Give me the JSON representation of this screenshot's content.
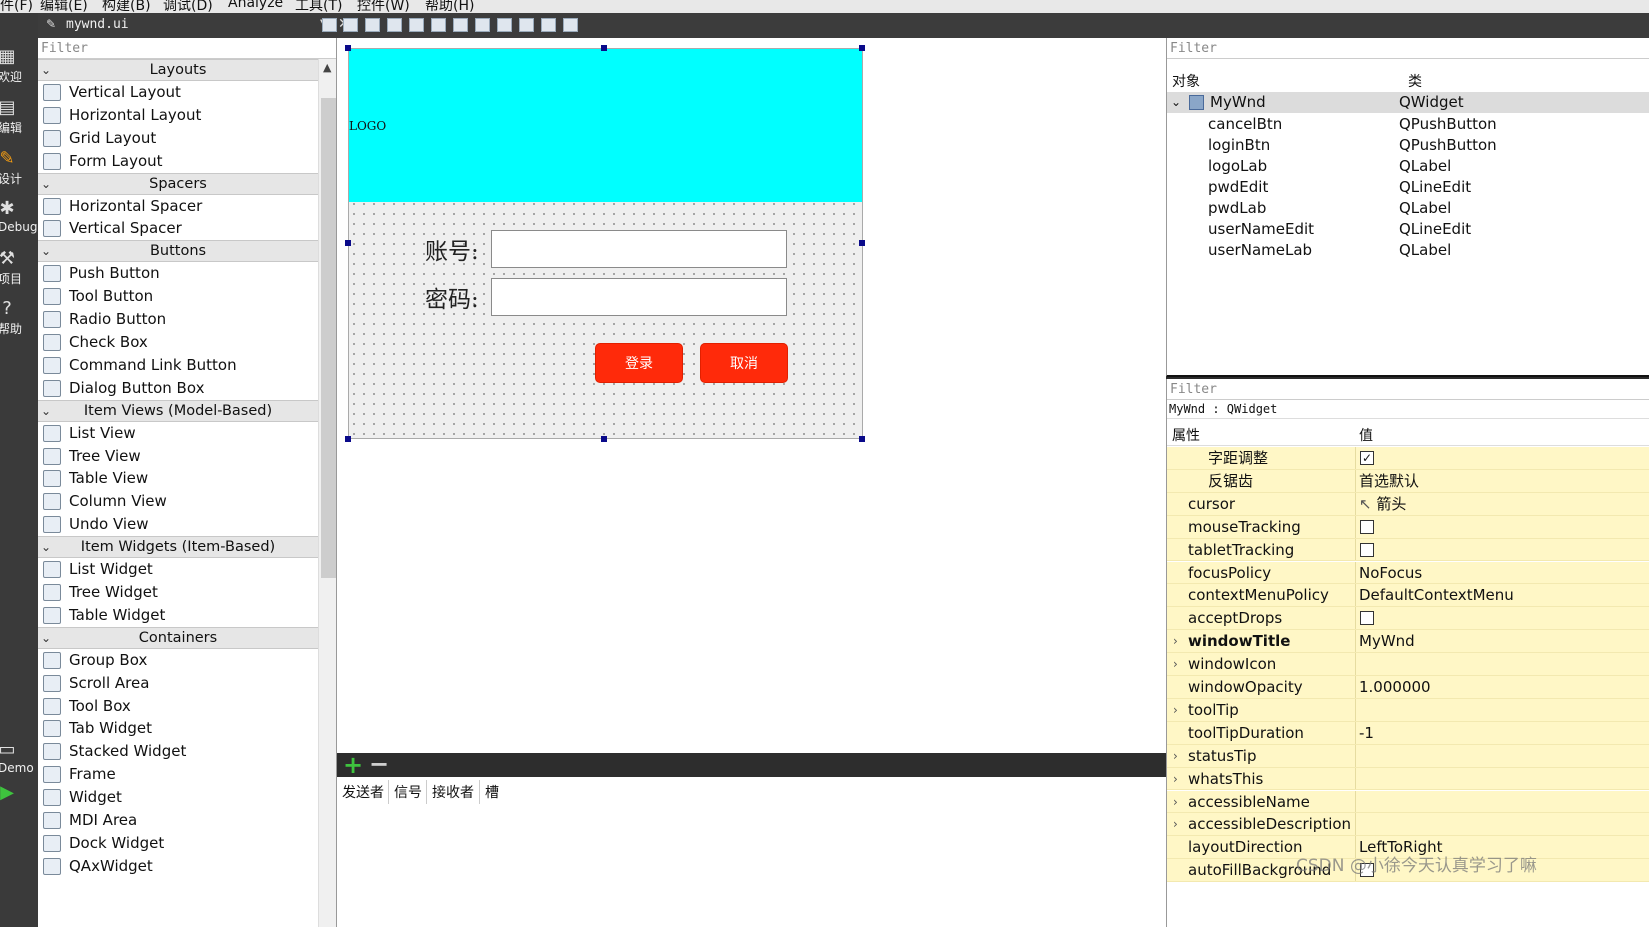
{
  "menubar": {
    "items": [
      "件(F)",
      "编辑(E)",
      "构建(B)",
      "调试(D)",
      "Analyze",
      "工具(T)",
      "控件(W)",
      "帮助(H)"
    ]
  },
  "modes": [
    {
      "label": "欢迎",
      "icon": "grid-icon"
    },
    {
      "label": "编辑",
      "icon": "document-icon"
    },
    {
      "label": "设计",
      "icon": "pencil-icon"
    },
    {
      "label": "Debug",
      "icon": "bug-icon"
    },
    {
      "label": "项目",
      "icon": "wrench-icon"
    },
    {
      "label": "帮助",
      "icon": "help-icon"
    },
    {
      "label": "Demo",
      "icon": "monitor-icon"
    },
    {
      "label": "Debug",
      "icon": "run-icon"
    }
  ],
  "editor_tab": {
    "filename": "mywnd.ui"
  },
  "widget_box": {
    "filter_placeholder": "Filter",
    "categories": [
      {
        "title": "Layouts",
        "items": [
          "Vertical Layout",
          "Horizontal Layout",
          "Grid Layout",
          "Form Layout"
        ]
      },
      {
        "title": "Spacers",
        "items": [
          "Horizontal Spacer",
          "Vertical Spacer"
        ]
      },
      {
        "title": "Buttons",
        "items": [
          "Push Button",
          "Tool Button",
          "Radio Button",
          "Check Box",
          "Command Link Button",
          "Dialog Button Box"
        ]
      },
      {
        "title": "Item Views (Model-Based)",
        "items": [
          "List View",
          "Tree View",
          "Table View",
          "Column View",
          "Undo View"
        ]
      },
      {
        "title": "Item Widgets (Item-Based)",
        "items": [
          "List Widget",
          "Tree Widget",
          "Table Widget"
        ]
      },
      {
        "title": "Containers",
        "items": [
          "Group Box",
          "Scroll Area",
          "Tool Box",
          "Tab Widget",
          "Stacked Widget",
          "Frame",
          "Widget",
          "MDI Area",
          "Dock Widget",
          "QAxWidget"
        ]
      }
    ]
  },
  "form": {
    "logo_text": "LOGO",
    "account_label": "账号:",
    "password_label": "密码:",
    "login_button": "登录",
    "cancel_button": "取消",
    "logo_color": "#00ffff",
    "button_color": "#ff2a0a"
  },
  "signal_slot": {
    "columns": [
      "发送者",
      "信号",
      "接收者",
      "槽"
    ]
  },
  "object_inspector": {
    "filter_placeholder": "Filter",
    "col_object": "对象",
    "col_class": "类",
    "root": {
      "name": "MyWnd",
      "class": "QWidget"
    },
    "children": [
      {
        "name": "cancelBtn",
        "class": "QPushButton"
      },
      {
        "name": "loginBtn",
        "class": "QPushButton"
      },
      {
        "name": "logoLab",
        "class": "QLabel"
      },
      {
        "name": "pwdEdit",
        "class": "QLineEdit"
      },
      {
        "name": "pwdLab",
        "class": "QLabel"
      },
      {
        "name": "userNameEdit",
        "class": "QLineEdit"
      },
      {
        "name": "userNameLab",
        "class": "QLabel"
      }
    ]
  },
  "property_editor": {
    "filter_placeholder": "Filter",
    "class_line": "MyWnd : QWidget",
    "col_property": "属性",
    "col_value": "值",
    "rows": [
      {
        "name": "字距调整",
        "value": "",
        "checkbox": "checked",
        "indent": 2
      },
      {
        "name": "反锯齿",
        "value": "首选默认",
        "indent": 2
      },
      {
        "name": "cursor",
        "value": "箭头",
        "indent": 1,
        "cursor_icon": true
      },
      {
        "name": "mouseTracking",
        "value": "",
        "checkbox": "unchecked",
        "indent": 1
      },
      {
        "name": "tabletTracking",
        "value": "",
        "checkbox": "unchecked",
        "indent": 1
      },
      {
        "name": "focusPolicy",
        "value": "NoFocus",
        "indent": 1
      },
      {
        "name": "contextMenuPolicy",
        "value": "DefaultContextMenu",
        "indent": 1
      },
      {
        "name": "acceptDrops",
        "value": "",
        "checkbox": "unchecked",
        "indent": 1
      },
      {
        "name": "windowTitle",
        "value": "MyWnd",
        "indent": 1,
        "expandable": true,
        "bold": true
      },
      {
        "name": "windowIcon",
        "value": "",
        "indent": 1,
        "expandable": true
      },
      {
        "name": "windowOpacity",
        "value": "1.000000",
        "indent": 1
      },
      {
        "name": "toolTip",
        "value": "",
        "indent": 1,
        "expandable": true
      },
      {
        "name": "toolTipDuration",
        "value": "-1",
        "indent": 1
      },
      {
        "name": "statusTip",
        "value": "",
        "indent": 1,
        "expandable": true
      },
      {
        "name": "whatsThis",
        "value": "",
        "indent": 1,
        "expandable": true
      },
      {
        "name": "accessibleName",
        "value": "",
        "indent": 1,
        "expandable": true
      },
      {
        "name": "accessibleDescription",
        "value": "",
        "indent": 1,
        "expandable": true
      },
      {
        "name": "layoutDirection",
        "value": "LeftToRight",
        "indent": 1
      },
      {
        "name": "autoFillBackground",
        "value": "",
        "checkbox": "unchecked",
        "indent": 1
      }
    ]
  },
  "watermark": "CSDN @小徐今天认真学习了嘛"
}
